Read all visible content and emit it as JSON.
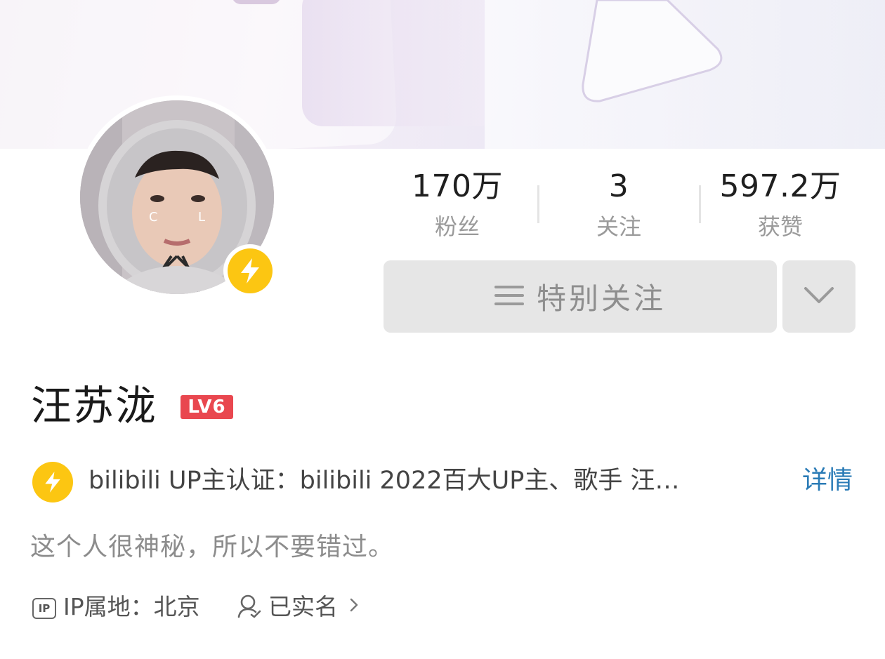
{
  "profile": {
    "name": "汪苏泷",
    "level_badge": "LV6"
  },
  "stats": [
    {
      "value": "170万",
      "label": "粉丝"
    },
    {
      "value": "3",
      "label": "关注"
    },
    {
      "value": "597.2万",
      "label": "获赞"
    }
  ],
  "actions": {
    "follow_label": "特别关注",
    "follow_icon": "list-icon",
    "more_icon": "chevron-down-icon"
  },
  "certification": {
    "text": "bilibili UP主认证：bilibili 2022百大UP主、歌手 汪…",
    "detail_link": "详情",
    "icon": "lightning-icon"
  },
  "bio": "这个人很神秘，所以不要错过。",
  "meta": {
    "ip_location": "IP属地：北京",
    "ip_icon_text": "IP",
    "realname": "已实名"
  },
  "colors": {
    "level_badge": "#e9474f",
    "verify_yellow": "#fcc612",
    "link_blue": "#2a7bb6",
    "button_gray": "#e6e6e6"
  }
}
